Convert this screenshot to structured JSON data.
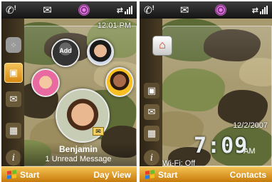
{
  "left_screen": {
    "time": "12:01 PM",
    "contact_add_label": "Add",
    "selected_contact_name": "Benjamin",
    "selected_contact_message": "1 Unread Message",
    "softkey_left": "Start",
    "softkey_right": "Day View"
  },
  "right_screen": {
    "date": "12/2/2007",
    "time": "7:09",
    "ampm": "AM",
    "wifi_status": "Wi-Fi: Off",
    "softkey_left": "Start",
    "softkey_right": "Contacts"
  },
  "icons": {
    "status_missed_call": "missed-call-icon",
    "status_mail": "mail-icon",
    "status_center": "home-orb-icon",
    "status_sync": "sync-icon",
    "status_signal": "signal-icon",
    "start_logo": "windows-flag-icon"
  },
  "colors": {
    "softbar": "#e09a1e",
    "status_bar": "#1e1e1e",
    "rail_selected": "#f0b040"
  }
}
